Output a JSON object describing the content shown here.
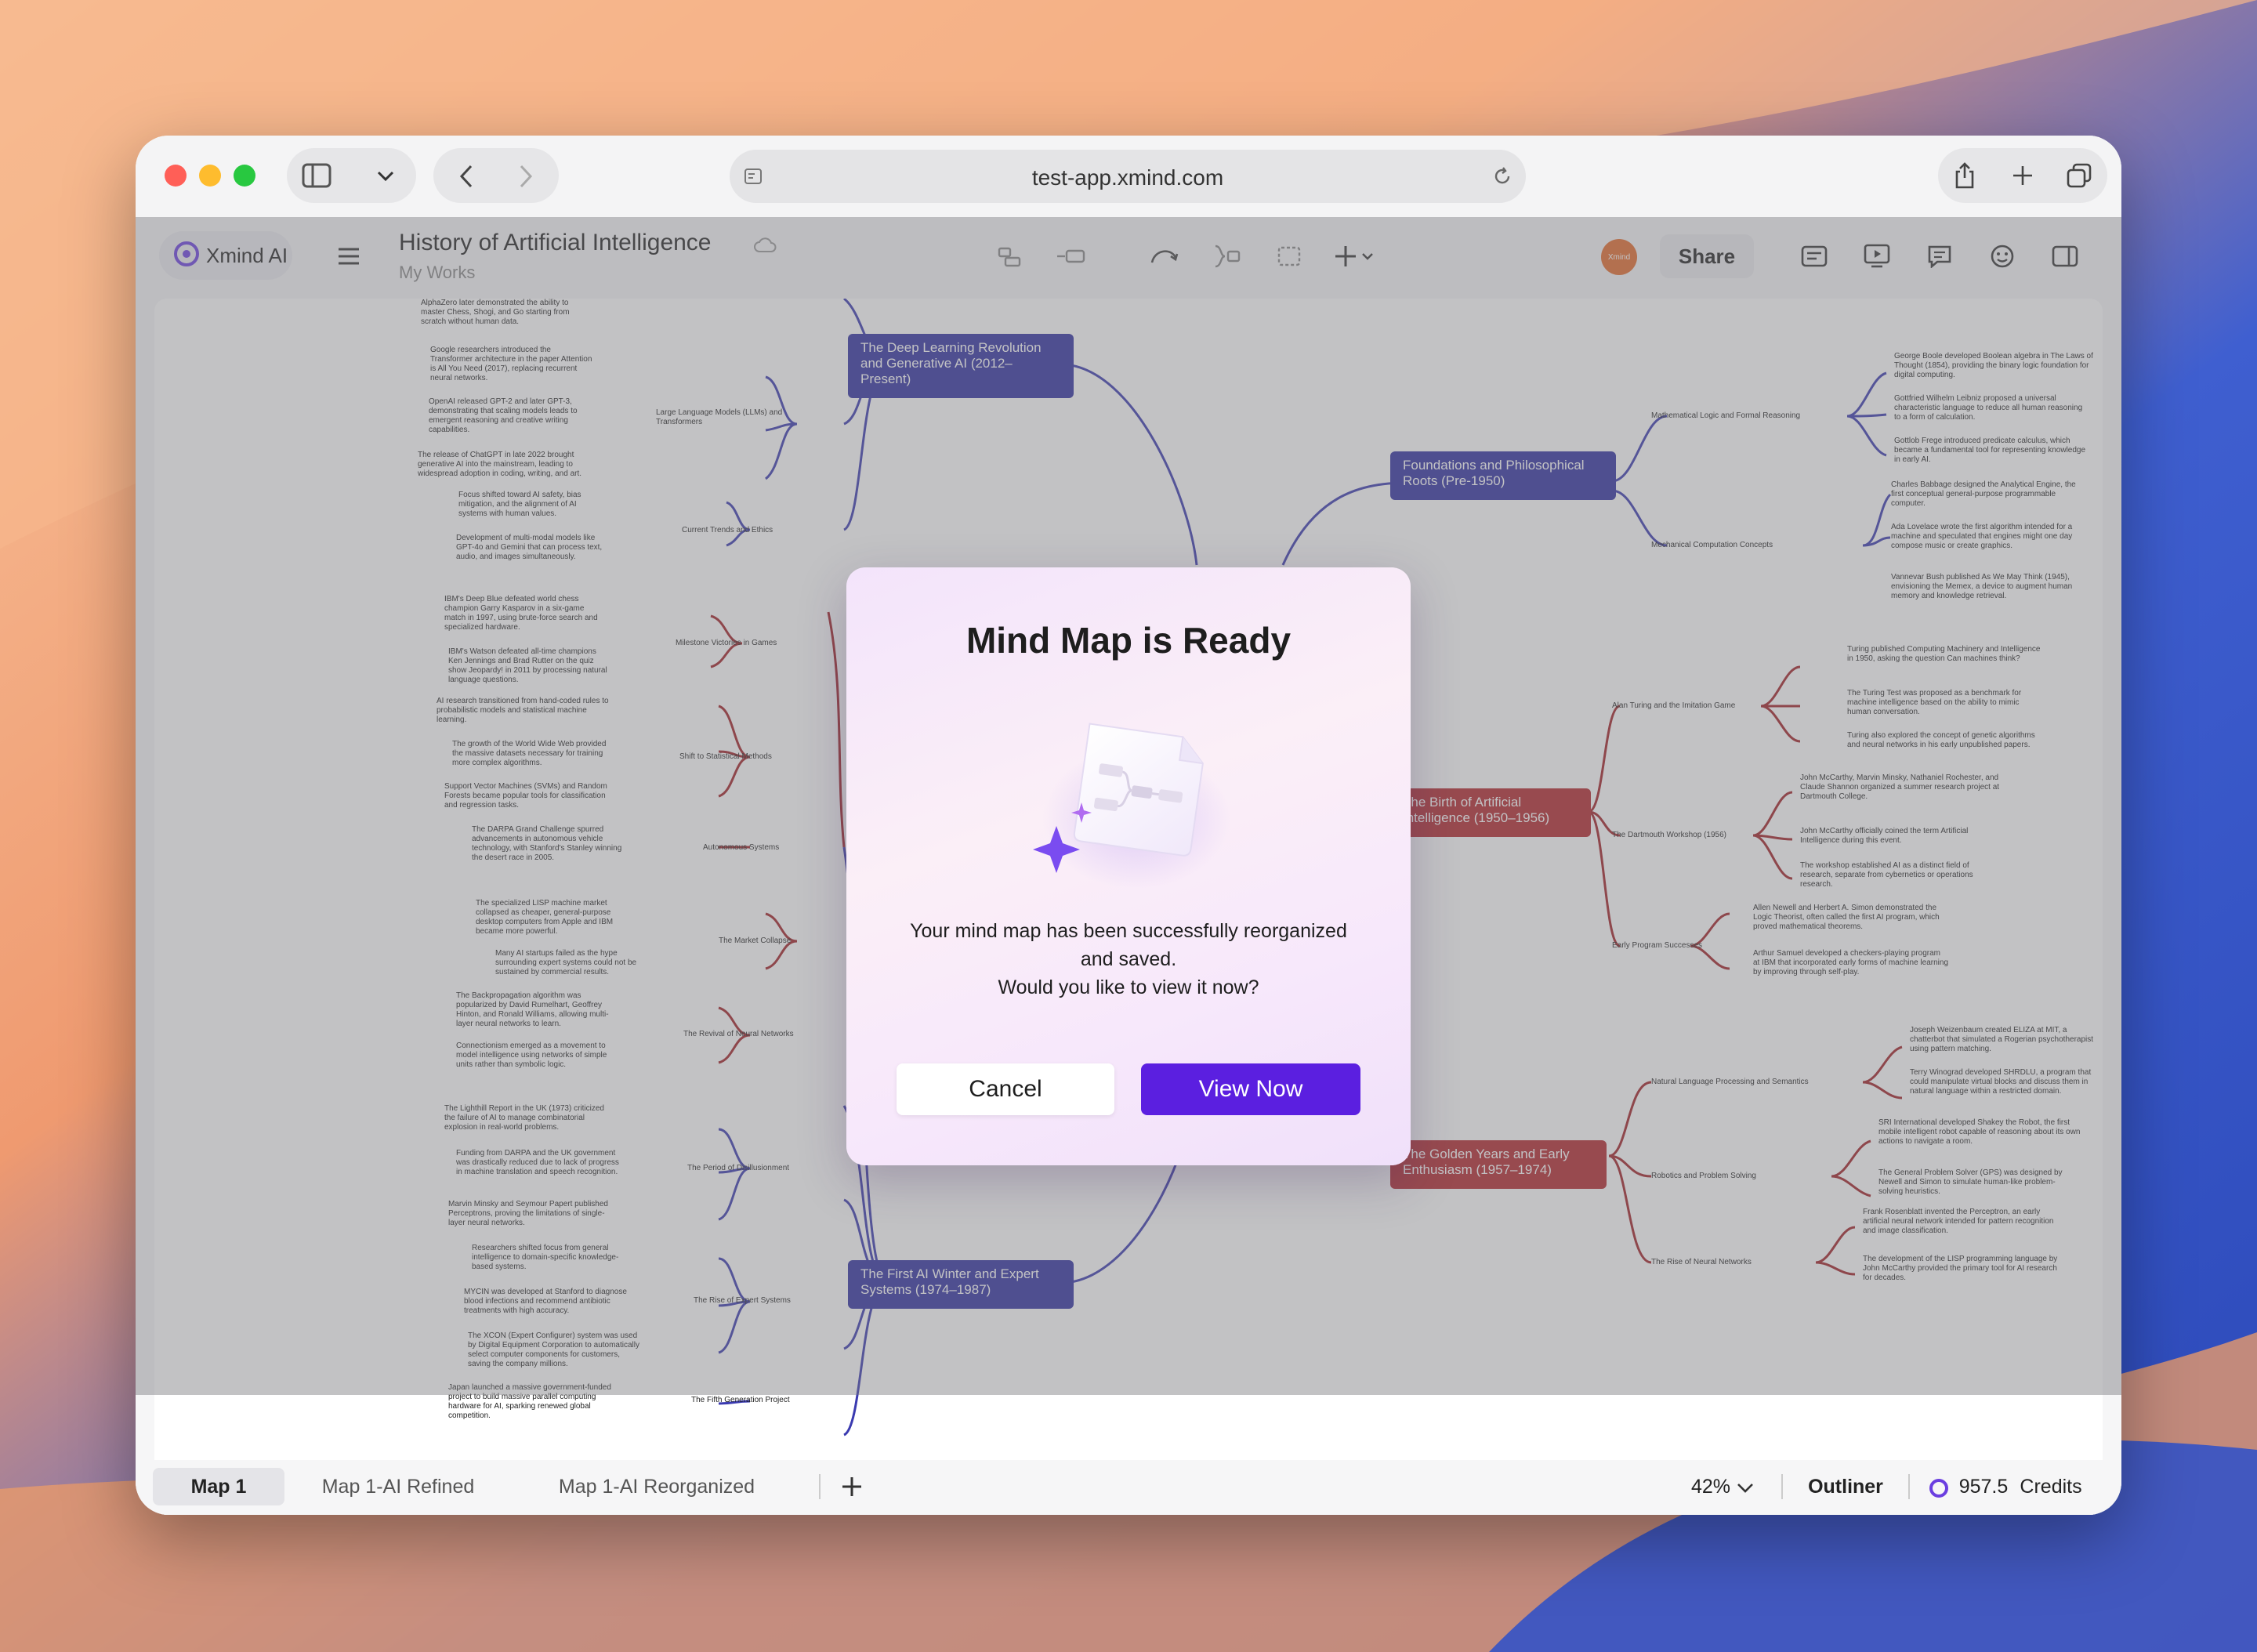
{
  "browser": {
    "url": "test-app.xmind.com"
  },
  "app": {
    "brand": "Xmind AI",
    "doc_title": "History of Artificial Intelligence",
    "doc_subtitle": "My Works",
    "avatar_text": "Xmind",
    "share_label": "Share"
  },
  "mindmap": {
    "left_topics": [
      {
        "label": "The Deep Learning Revolution and Generative AI (2012–Present)"
      },
      {
        "label": "The First AI Winter and Expert Systems (1974–1987)"
      }
    ],
    "right_topics": [
      {
        "label": "Foundations and Philosophical Roots (Pre-1950)"
      },
      {
        "label": "The Birth of Artificial Intelligence (1950–1956)"
      },
      {
        "label": "The Golden Years and Early Enthusiasm (1957–1974)"
      }
    ],
    "subtopics_left": [
      "Large Language Models (LLMs) and Transformers",
      "Current Trends and Ethics",
      "Milestone Victories in Games",
      "Shift to Statistical Methods",
      "Autonomous Systems",
      "The Market Collapse",
      "The Revival of Neural Networks",
      "The Period of Disillusionment",
      "The Rise of Expert Systems",
      "The Fifth Generation Project"
    ],
    "subtopics_right": [
      "Mathematical Logic and Formal Reasoning",
      "Mechanical Computation Concepts",
      "Alan Turing and the Imitation Game",
      "The Dartmouth Workshop (1956)",
      "Early Program Successes",
      "Natural Language Processing and Semantics",
      "Robotics and Problem Solving",
      "The Rise of Neural Networks"
    ],
    "details_left": [
      "AlphaZero later demonstrated the ability to master Chess, Shogi, and Go starting from scratch without human data.",
      "Google researchers introduced the Transformer architecture in the paper Attention is All You Need (2017), replacing recurrent neural networks.",
      "OpenAI released GPT-2 and later GPT-3, demonstrating that scaling models leads to emergent reasoning and creative writing capabilities.",
      "The release of ChatGPT in late 2022 brought generative AI into the mainstream, leading to widespread adoption in coding, writing, and art.",
      "Focus shifted toward AI safety, bias mitigation, and the alignment of AI systems with human values.",
      "Development of multi-modal models like GPT-4o and Gemini that can process text, audio, and images simultaneously.",
      "IBM's Deep Blue defeated world chess champion Garry Kasparov in a six-game match in 1997, using brute-force search and specialized hardware.",
      "IBM's Watson defeated all-time champions Ken Jennings and Brad Rutter on the quiz show Jeopardy! in 2011 by processing natural language questions.",
      "AI research transitioned from hand-coded rules to probabilistic models and statistical machine learning.",
      "The growth of the World Wide Web provided the massive datasets necessary for training more complex algorithms.",
      "Support Vector Machines (SVMs) and Random Forests became popular tools for classification and regression tasks.",
      "The DARPA Grand Challenge spurred advancements in autonomous vehicle technology, with Stanford's Stanley winning the desert race in 2005.",
      "The specialized LISP machine market collapsed as cheaper, general-purpose desktop computers from Apple and IBM became more powerful.",
      "Many AI startups failed as the hype surrounding expert systems could not be sustained by commercial results.",
      "The Backpropagation algorithm was popularized by David Rumelhart, Geoffrey Hinton, and Ronald Williams, allowing multi-layer neural networks to learn.",
      "Connectionism emerged as a movement to model intelligence using networks of simple units rather than symbolic logic.",
      "The Lighthill Report in the UK (1973) criticized the failure of AI to manage combinatorial explosion in real-world problems.",
      "Funding from DARPA and the UK government was drastically reduced due to lack of progress in machine translation and speech recognition.",
      "Marvin Minsky and Seymour Papert published Perceptrons, proving the limitations of single-layer neural networks.",
      "Researchers shifted focus from general intelligence to domain-specific knowledge-based systems.",
      "MYCIN was developed at Stanford to diagnose blood infections and recommend antibiotic treatments with high accuracy.",
      "The XCON (Expert Configurer) system was used by Digital Equipment Corporation to automatically select computer components for customers, saving the company millions.",
      "Japan launched a massive government-funded project to build massive parallel computing hardware for AI, sparking renewed global competition."
    ],
    "details_right": [
      "George Boole developed Boolean algebra in The Laws of Thought (1854), providing the binary logic foundation for digital computing.",
      "Gottfried Wilhelm Leibniz proposed a universal characteristic language to reduce all human reasoning to a form of calculation.",
      "Gottlob Frege introduced predicate calculus, which became a fundamental tool for representing knowledge in early AI.",
      "Charles Babbage designed the Analytical Engine, the first conceptual general-purpose programmable computer.",
      "Ada Lovelace wrote the first algorithm intended for a machine and speculated that engines might one day compose music or create graphics.",
      "Vannevar Bush published As We May Think (1945), envisioning the Memex, a device to augment human memory and knowledge retrieval.",
      "Turing published Computing Machinery and Intelligence in 1950, asking the question Can machines think?",
      "The Turing Test was proposed as a benchmark for machine intelligence based on the ability to mimic human conversation.",
      "Turing also explored the concept of genetic algorithms and neural networks in his early unpublished papers.",
      "John McCarthy, Marvin Minsky, Nathaniel Rochester, and Claude Shannon organized a summer research project at Dartmouth College.",
      "John McCarthy officially coined the term Artificial Intelligence during this event.",
      "The workshop established AI as a distinct field of research, separate from cybernetics or operations research.",
      "Allen Newell and Herbert A. Simon demonstrated the Logic Theorist, often called the first AI program, which proved mathematical theorems.",
      "Arthur Samuel developed a checkers-playing program at IBM that incorporated early forms of machine learning by improving through self-play.",
      "Joseph Weizenbaum created ELIZA at MIT, a chatterbot that simulated a Rogerian psychotherapist using pattern matching.",
      "Terry Winograd developed SHRDLU, a program that could manipulate virtual blocks and discuss them in natural language within a restricted domain.",
      "SRI International developed Shakey the Robot, the first mobile intelligent robot capable of reasoning about its own actions to navigate a room.",
      "The General Problem Solver (GPS) was designed by Newell and Simon to simulate human-like problem-solving heuristics.",
      "Frank Rosenblatt invented the Perceptron, an early artificial neural network intended for pattern recognition and image classification.",
      "The development of the LISP programming language by John McCarthy provided the primary tool for AI research for decades."
    ]
  },
  "modal": {
    "title": "Mind Map is Ready",
    "message_line1": "Your mind map has been successfully reorganized and saved.",
    "message_line2": "Would you like to view it now?",
    "cancel_label": "Cancel",
    "view_label": "View Now"
  },
  "bottom": {
    "tabs": [
      {
        "label": "Map 1",
        "active": true
      },
      {
        "label": "Map 1-AI Refined",
        "active": false
      },
      {
        "label": "Map 1-AI Reorganized",
        "active": false
      }
    ],
    "zoom": "42%",
    "outliner_label": "Outliner",
    "credits_value": "957.5",
    "credits_label": "Credits"
  },
  "colors": {
    "accent": "#5b1fe0",
    "topic_blue": "#2f2fa0",
    "topic_red": "#b3262b",
    "line_blue": "#3a3ab0",
    "line_red": "#a02026"
  }
}
